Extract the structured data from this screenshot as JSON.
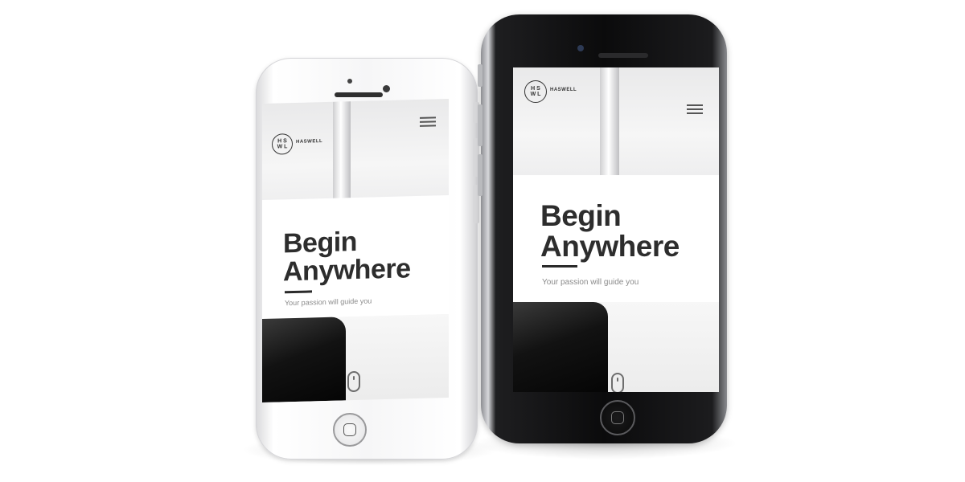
{
  "page": {
    "background": "#ffffff"
  },
  "phones": {
    "white": {
      "color": "silver-white",
      "brand": "HASWELL",
      "logo_text": "H S\nW L",
      "title_line1": "Begin",
      "title_line2": "Anywhere",
      "subtitle": "Your passion will guide you"
    },
    "black": {
      "color": "space-gray",
      "brand": "HASWELL",
      "logo_text": "H S\nW L",
      "title_line1": "Begin",
      "title_line2": "Anywhere",
      "subtitle": "Your passion will guide you"
    }
  },
  "icons": [
    "logo-icon",
    "menu-icon",
    "mouse-scroll-icon",
    "home-button-icon"
  ]
}
